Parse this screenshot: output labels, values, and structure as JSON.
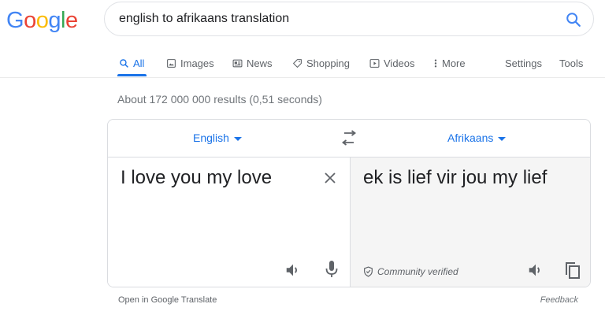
{
  "logo": {
    "text": "Google",
    "letters": [
      "G",
      "o",
      "o",
      "g",
      "l",
      "e"
    ],
    "colors": [
      "#4285f4",
      "#ea4335",
      "#fbbc05",
      "#4285f4",
      "#34a853",
      "#ea4335"
    ]
  },
  "search": {
    "query": "english to afrikaans translation",
    "icon": "search-icon"
  },
  "tabs": [
    {
      "label": "All",
      "icon": "search-icon",
      "active": true
    },
    {
      "label": "Images",
      "icon": "image-icon"
    },
    {
      "label": "News",
      "icon": "news-icon"
    },
    {
      "label": "Shopping",
      "icon": "tag-icon"
    },
    {
      "label": "Videos",
      "icon": "play-icon"
    },
    {
      "label": "More",
      "icon": "more-vert-icon"
    }
  ],
  "tools": {
    "settings": "Settings",
    "tools": "Tools"
  },
  "stats": "About 172 000 000 results (0,51 seconds)",
  "translate": {
    "source_lang": "English",
    "target_lang": "Afrikaans",
    "source_text": "I love you my love",
    "target_text": "ek is lief vir jou my lief",
    "verified": "Community verified"
  },
  "footer": {
    "open": "Open in Google Translate",
    "feedback": "Feedback"
  },
  "colors": {
    "accent": "#1a73e8",
    "muted": "#5f6368",
    "border": "#dadce0",
    "target_bg": "#f5f5f5"
  }
}
